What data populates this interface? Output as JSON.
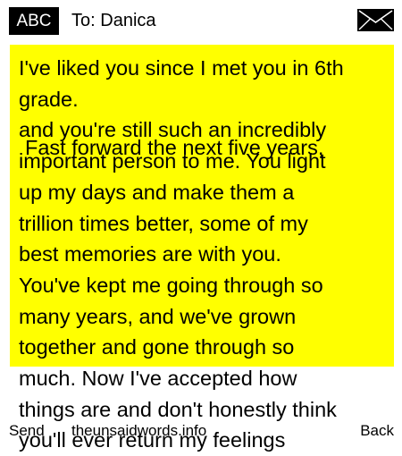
{
  "header": {
    "mode_badge": "ABC",
    "to_label": "To:",
    "recipient": "Danica",
    "icon": "envelope-icon"
  },
  "message": {
    "text": "I've liked you since I met you in 6th\ngrade.\nand you're still such an incredibly\nimportant person to me. You light\nup my days and make them a\ntrillion times better, some of my\nbest memories are with you.\nYou've kept me going through so\nmany years, and we've grown\ntogether and gone through so\nmuch. Now I've accepted how\nthings are and don't honestly think\nyou'll ever return my feelings",
    "overlap_line": "Fast forward the next five years,"
  },
  "softkeys": {
    "left": "Send",
    "middle": "theunsaidwords.info",
    "right": "Back"
  },
  "colors": {
    "message_background": "#ffff00",
    "badge_background": "#000000"
  }
}
